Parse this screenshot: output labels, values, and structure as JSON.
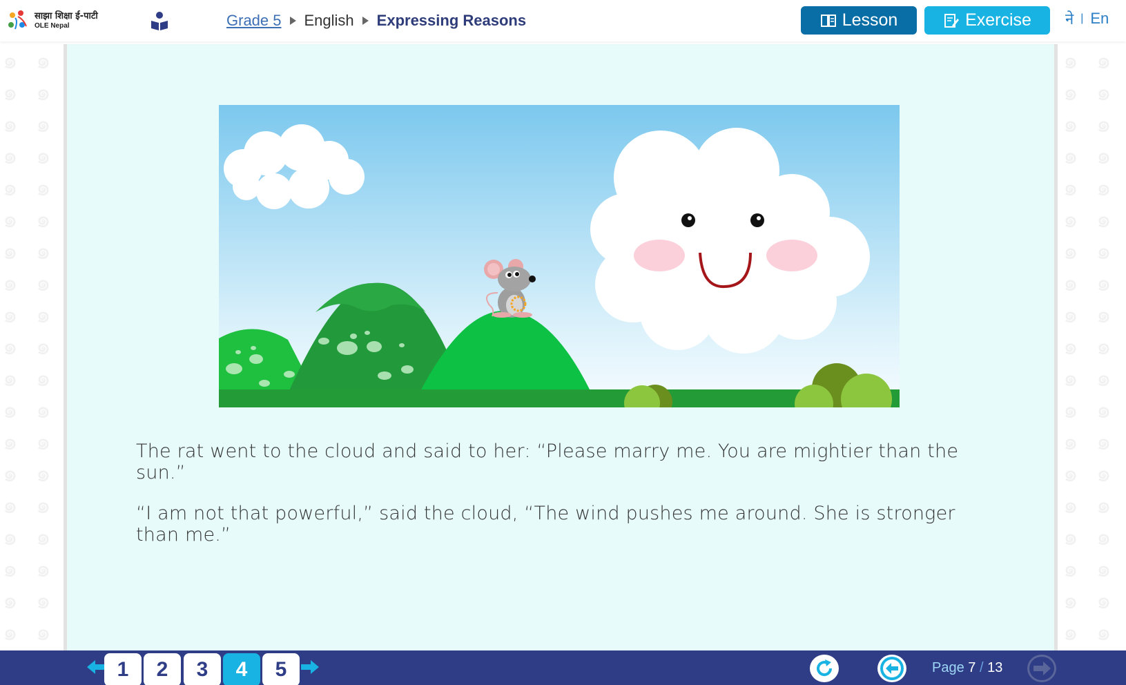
{
  "header": {
    "logo_np": "साझा शिक्षा ई-पाटी",
    "logo_en": "OLE Nepal",
    "breadcrumb": {
      "grade": "Grade 5",
      "subject": "English",
      "lesson": "Expressing Reasons"
    },
    "lesson_button": "Lesson",
    "exercise_button": "Exercise",
    "lang_ne": "ने",
    "lang_sep": "|",
    "lang_en": "En"
  },
  "story": {
    "line1": "The rat went to the cloud and said to her: “Please marry me. You are mightier than the sun.”",
    "line2": "“I am not that powerful,” said the cloud, “The wind pushes me around. She is stronger than me.”"
  },
  "footer": {
    "pages": [
      "1",
      "2",
      "3",
      "4",
      "5"
    ],
    "active_page": "4",
    "page_label": "Page",
    "page_current": "7",
    "page_sep": "/",
    "page_total": "13"
  },
  "colors": {
    "header_bg": "#ffffff",
    "content_bg": "#e6fbfa",
    "footer_bg": "#2e3d86",
    "lesson_btn": "#0a6ea6",
    "exercise_btn": "#19b3e3",
    "active_page": "#19b3e3"
  },
  "icons": {
    "reader": "reader-icon",
    "lesson": "book-icon",
    "exercise": "pencil-notebook-icon",
    "prev_arrow": "arrow-left-icon",
    "next_arrow": "arrow-right-icon",
    "reload": "reload-icon",
    "back": "back-circle-icon",
    "forward": "forward-circle-icon"
  }
}
